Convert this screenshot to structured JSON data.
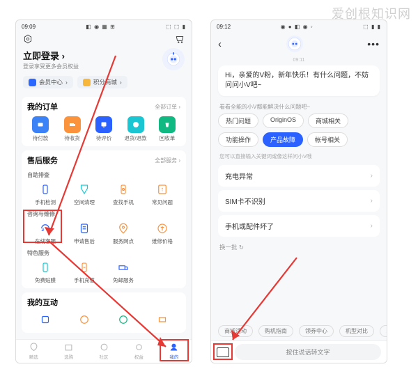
{
  "watermark": "爱创根知识网",
  "left": {
    "status": {
      "time": "09:09",
      "icons": "◧ ◉ ▦ ⊞",
      "right": "⬚ ⬚ ▮"
    },
    "login": {
      "title": "立即登录",
      "arrow": "›",
      "subtitle": "登录享受更多会员权益"
    },
    "pills": {
      "member": "会员中心",
      "points": "积分商城",
      "chev": "›"
    },
    "orders": {
      "title": "我的订单",
      "more": "全部订单 ›",
      "items": [
        {
          "label": "待付款"
        },
        {
          "label": "待收货"
        },
        {
          "label": "待评价"
        },
        {
          "label": "退货/退款"
        },
        {
          "label": "回收单"
        }
      ]
    },
    "aftersale": {
      "title": "售后服务",
      "more": "全部服务 ›",
      "selfcheck_title": "自助排查",
      "selfcheck": [
        {
          "label": "手机检测"
        },
        {
          "label": "空间清理"
        },
        {
          "label": "查找手机"
        },
        {
          "label": "常见问题"
        }
      ],
      "consult_title": "咨询与维修",
      "consult": [
        {
          "label": "在线客服"
        },
        {
          "label": "申请售后"
        },
        {
          "label": "服务网点"
        },
        {
          "label": "维修价格"
        }
      ],
      "special_title": "特色服务",
      "special": [
        {
          "label": "免费贴膜"
        },
        {
          "label": "手机充值"
        },
        {
          "label": "免邮服务"
        }
      ]
    },
    "interact": {
      "title": "我的互动"
    },
    "nav": [
      {
        "label": "精选"
      },
      {
        "label": "选购"
      },
      {
        "label": "社区"
      },
      {
        "label": "权益"
      },
      {
        "label": "我的"
      }
    ]
  },
  "right": {
    "status": {
      "time": "09:12",
      "icons": "◉ ● ◧ ◉ ◦",
      "right": "⬚ ▮ ▮"
    },
    "time_chip": "09:11",
    "greeting": "Hi，亲爱的V粉，新年快乐！有什么问题，不妨问问小V吧~",
    "sugg_title": "看看全能的小V都能解决什么问题吧~",
    "chips": [
      "热门问题",
      "OriginOS",
      "商城相关",
      "功能操作",
      "产品故障",
      "帐号相关"
    ],
    "hint": "您可以直接输入关键词或像这样问小V哦",
    "faq": [
      "充电异常",
      "SIM卡不识别",
      "手机或配件坏了"
    ],
    "swap": "换一批 ↻",
    "tabs": [
      "商城活动",
      "购机指南",
      "领券中心",
      "机型对比",
      "以"
    ],
    "more": "•••",
    "voice": "按住说话转文字"
  }
}
